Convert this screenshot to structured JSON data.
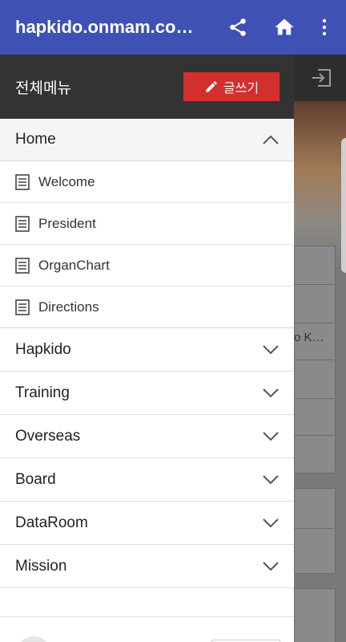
{
  "appbar": {
    "title": "hapkido.onmam.co…",
    "icons": [
      "share-icon",
      "home-icon",
      "more-vert-icon"
    ]
  },
  "background_page": {
    "snippet": "o K…"
  },
  "drawer": {
    "title": "전체메뉴",
    "write_button": "글쓰기",
    "sections": [
      {
        "label": "Home",
        "expanded": true,
        "items": [
          "Welcome",
          "President",
          "OrganChart",
          "Directions"
        ]
      },
      {
        "label": "Hapkido",
        "expanded": false
      },
      {
        "label": "Training",
        "expanded": false
      },
      {
        "label": "Overseas",
        "expanded": false
      },
      {
        "label": "Board",
        "expanded": false
      },
      {
        "label": "DataRoom",
        "expanded": false
      },
      {
        "label": "Mission",
        "expanded": false
      }
    ]
  },
  "colors": {
    "appbar": "#3f51b5",
    "drawer_header": "#333333",
    "write_button": "#d32f2f"
  }
}
